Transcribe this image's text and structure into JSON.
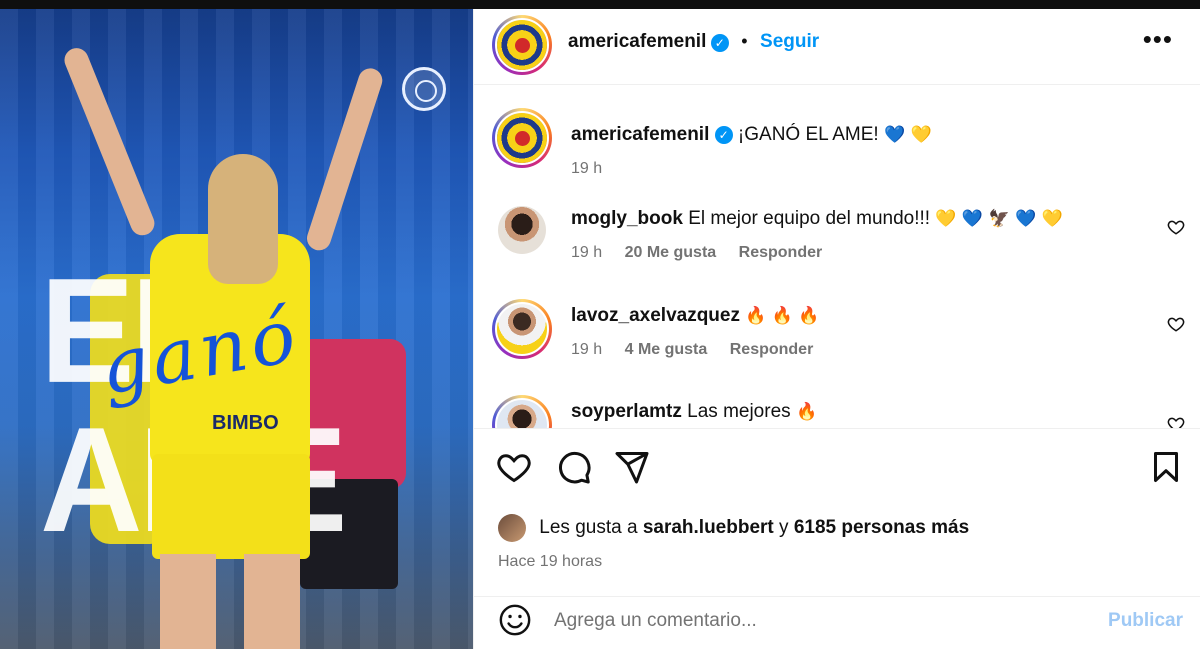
{
  "post": {
    "image_alt": "",
    "graphic_text_main": "EL AME",
    "graphic_text_script": "ganó",
    "sponsor": "BIMBO"
  },
  "header": {
    "username": "americafemenil",
    "verified": "✓",
    "separator": "•",
    "follow_label": "Seguir",
    "more_label": "•••"
  },
  "caption": {
    "username": "americafemenil",
    "text": "¡GANÓ EL AME!",
    "emojis": "💙 💛",
    "time": "19 h"
  },
  "comments": [
    {
      "username": "mogly_book",
      "text": "El mejor equipo del mundo!!!",
      "emojis": "💛 💙 🦅 💙 💛",
      "time": "19 h",
      "likes": "20 Me gusta",
      "reply_label": "Responder"
    },
    {
      "username": "lavoz_axelvazquez",
      "text": "",
      "emojis": "🔥 🔥 🔥",
      "time": "19 h",
      "likes": "4 Me gusta",
      "reply_label": "Responder"
    },
    {
      "username": "soyperlamtz",
      "text": "Las mejores",
      "emojis": "🔥",
      "time": "",
      "likes": "",
      "reply_label": ""
    }
  ],
  "likes": {
    "prefix": "Les gusta a",
    "first_user": "sarah.luebbert",
    "connector": "y",
    "others": "6185 personas más"
  },
  "time_ago": "Hace 19 horas",
  "composer": {
    "placeholder": "Agrega un comentario...",
    "publish_label": "Publicar"
  },
  "colors": {
    "accent": "#0095f6",
    "publish_disabled": "#9fc9f5",
    "meta_gray": "#737373"
  },
  "icons": [
    "more-options-icon",
    "heart-icon",
    "comment-icon",
    "share-icon",
    "bookmark-icon",
    "emoji-icon",
    "verified-icon"
  ]
}
